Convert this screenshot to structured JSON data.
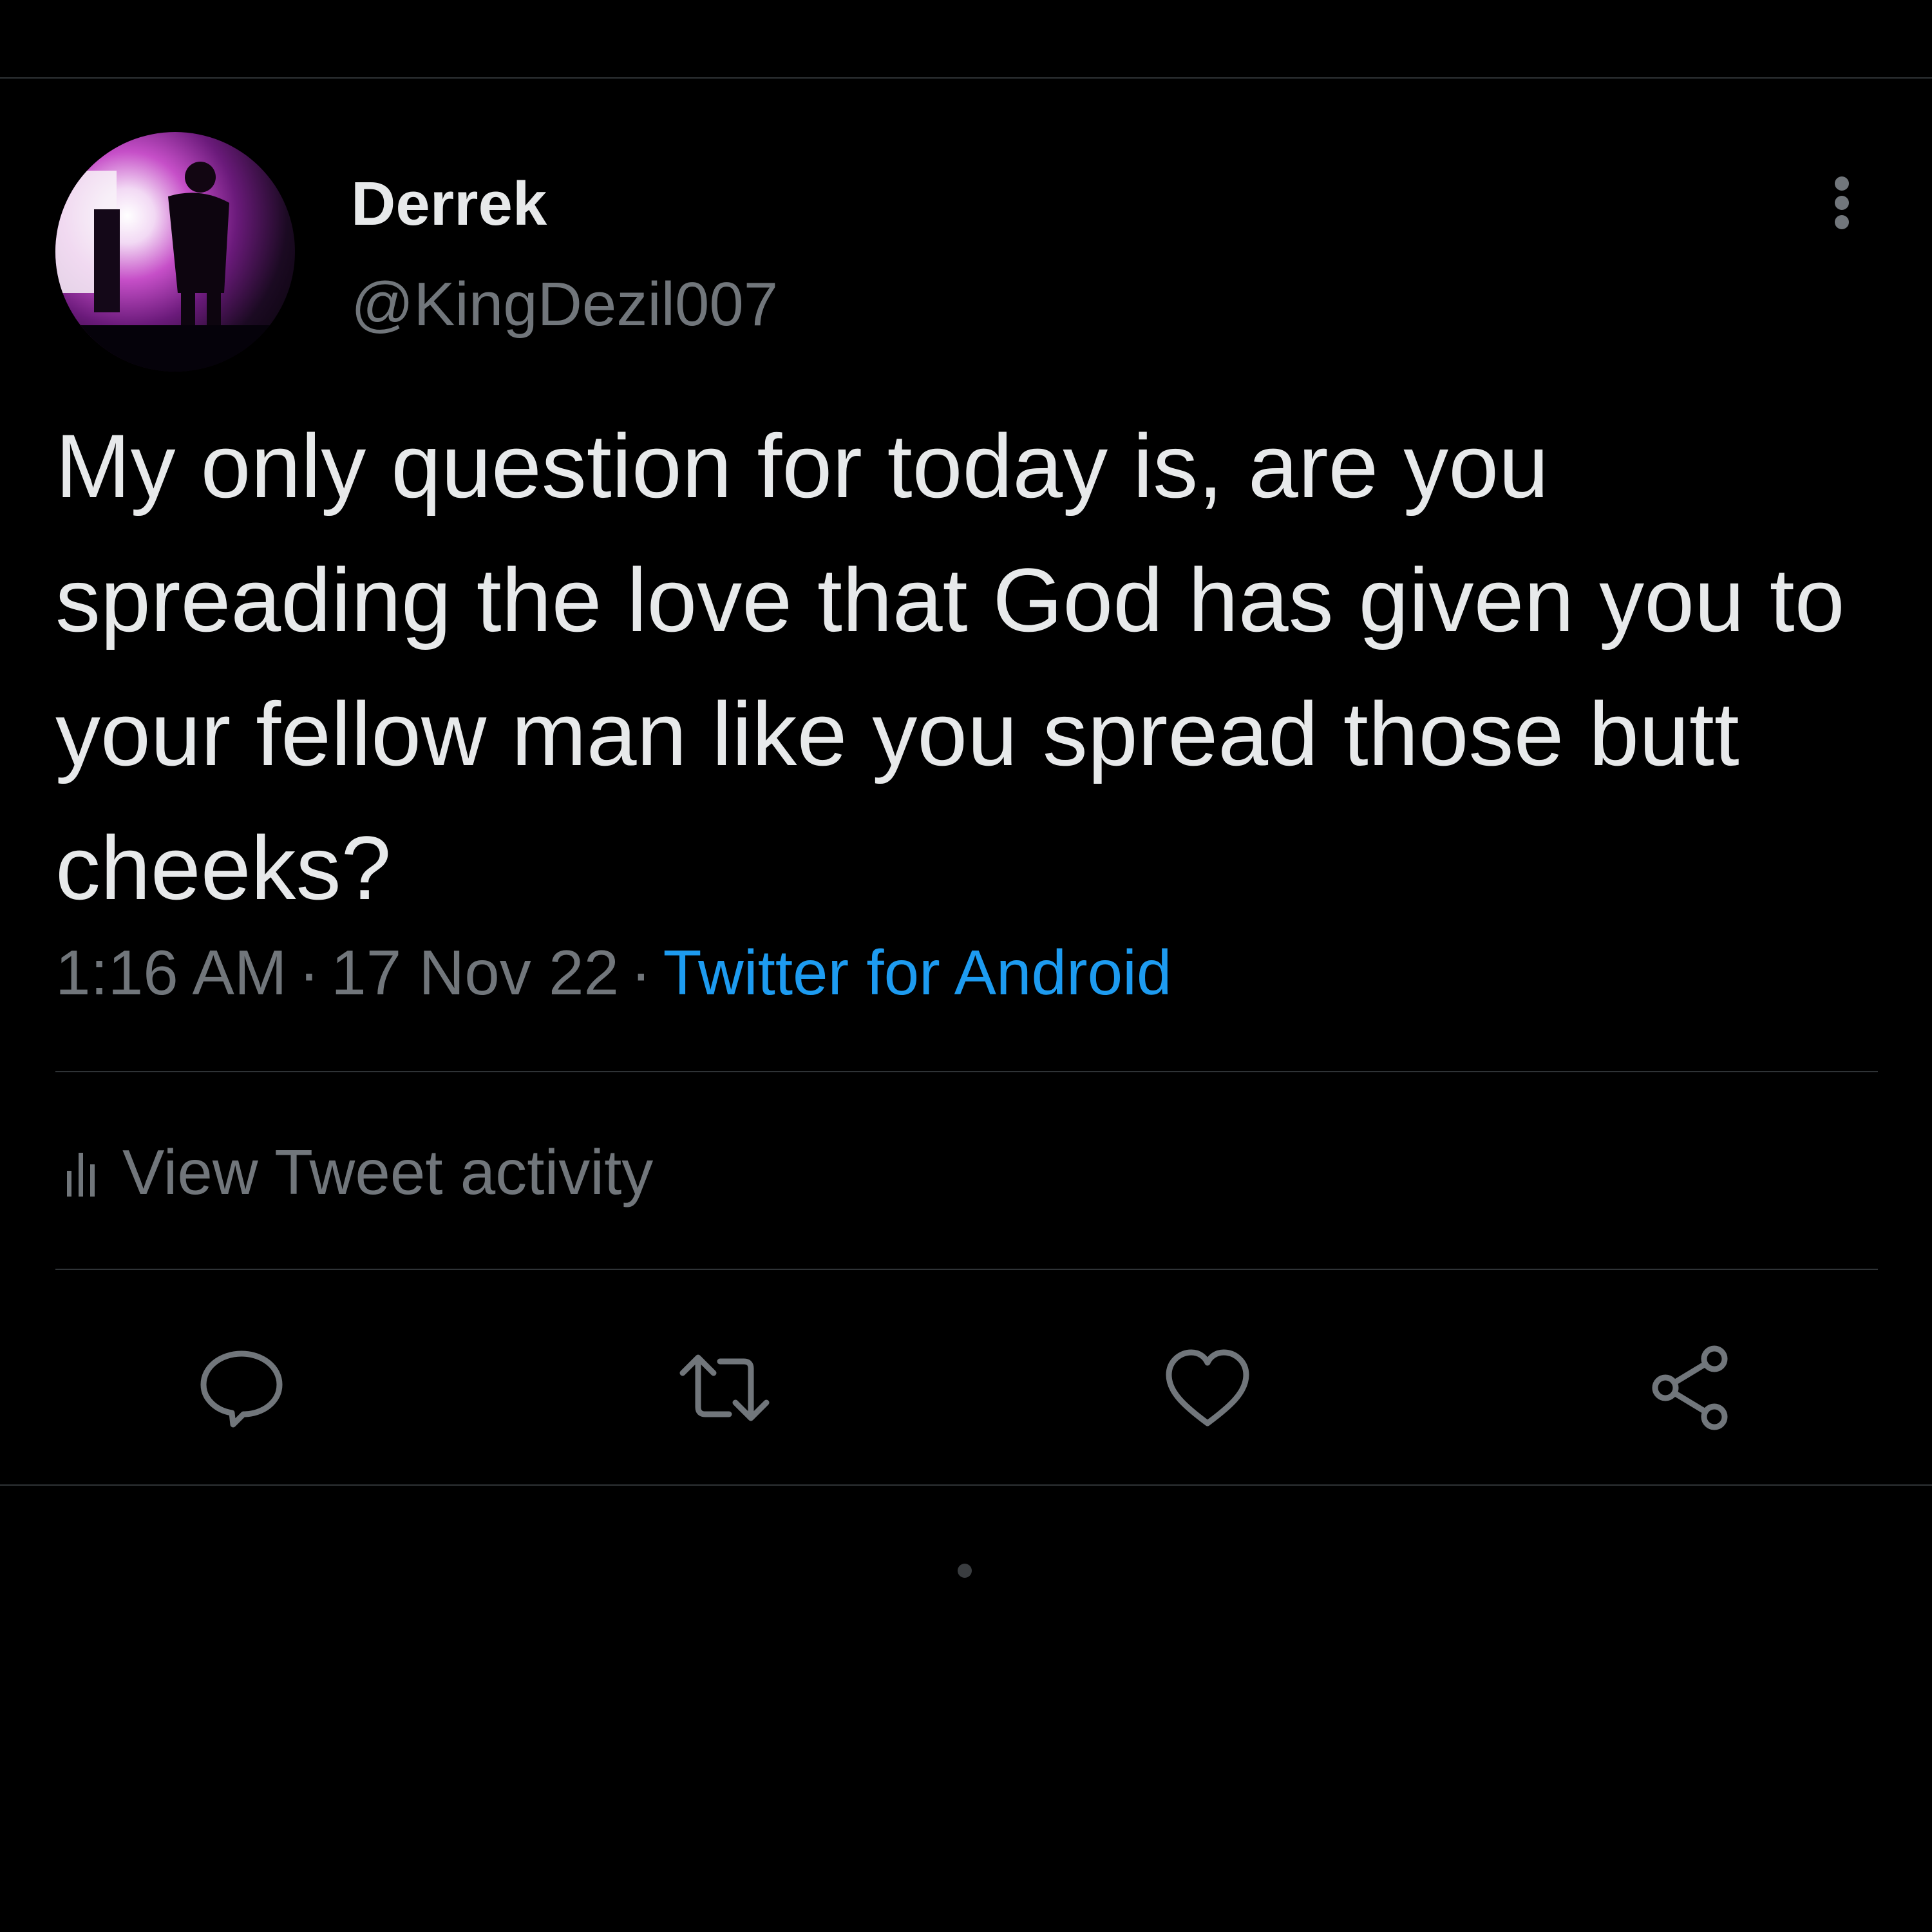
{
  "tweet": {
    "author": {
      "display_name": "Derrek",
      "handle": "@KingDezil007",
      "avatar": "stage-performer-photo"
    },
    "text": "My only question for today is, are you spreading the love that God has given you to your fellow man like you spread those butt cheeks?",
    "meta": {
      "time": "1:16 AM",
      "separator": "·",
      "date": "17 Nov 22",
      "source": "Twitter for Android"
    },
    "activity_label": "View Tweet activity"
  },
  "actions": [
    "reply-icon",
    "retweet-icon",
    "like-icon",
    "share-icon"
  ],
  "colors": {
    "background": "#000000",
    "text": "#e7e9ea",
    "secondary": "#71767b",
    "link": "#1d9bf0",
    "divider": "#2f3336"
  }
}
